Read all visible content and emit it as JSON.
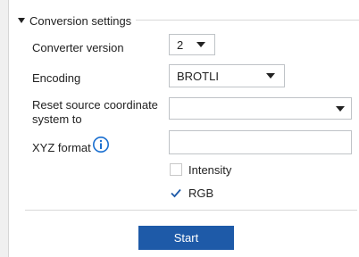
{
  "section": {
    "title": "Conversion settings",
    "expanded": true
  },
  "fields": {
    "converter_version": {
      "label": "Converter version",
      "value": "2"
    },
    "encoding": {
      "label": "Encoding",
      "value": "BROTLI"
    },
    "reset_source": {
      "label_line1": "Reset source coordinate",
      "label_line2": "system to",
      "value": ""
    },
    "xyz_format": {
      "label": "XYZ format",
      "value": "",
      "info_icon": "info-icon"
    }
  },
  "checkboxes": {
    "intensity": {
      "label": "Intensity",
      "checked": false
    },
    "rgb": {
      "label": "RGB",
      "checked": true
    }
  },
  "actions": {
    "start_label": "Start"
  },
  "colors": {
    "accent": "#1e5aa8",
    "info_icon": "#1a6fd0"
  }
}
